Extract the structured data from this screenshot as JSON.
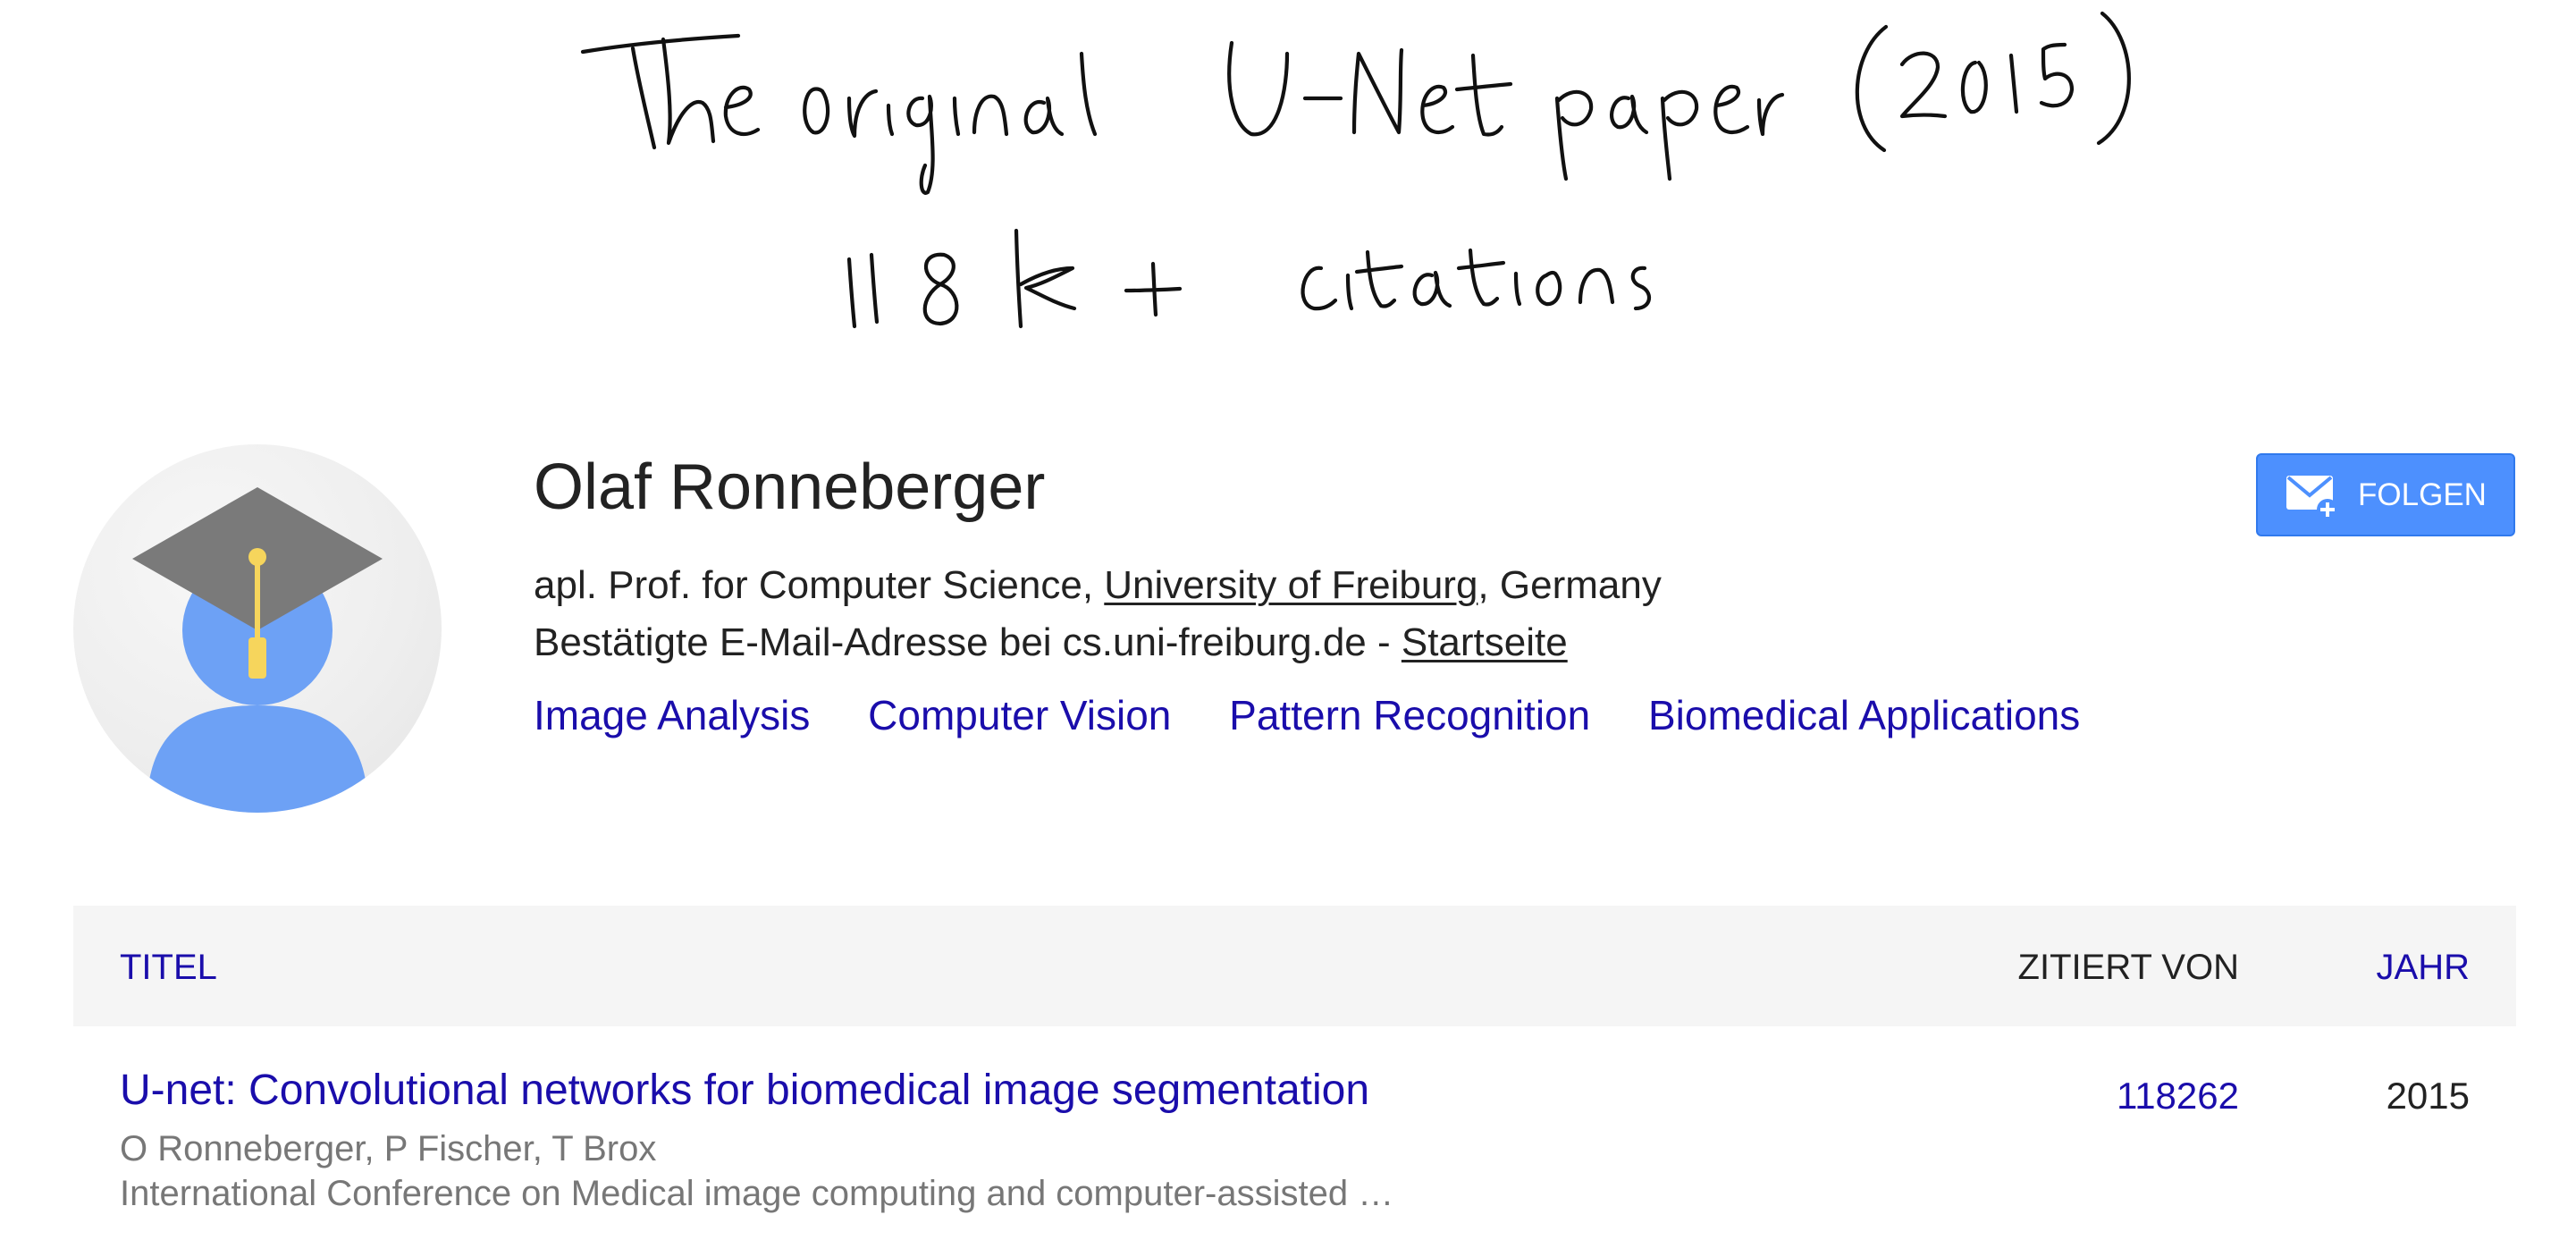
{
  "annotation": {
    "line1": "The original U-Net paper (2015)",
    "line2": "118k+ citations"
  },
  "profile": {
    "name": "Olaf Ronneberger",
    "affiliation_prefix": "apl. Prof. for Computer Science, ",
    "affiliation_link": "University of Freiburg",
    "affiliation_suffix": ", Germany",
    "email_text": "Bestätigte E-Mail-Adresse bei cs.uni-freiburg.de - ",
    "homepage_label": "Startseite",
    "interests": [
      "Image Analysis",
      "Computer Vision",
      "Pattern Recognition",
      "Biomedical Applications"
    ]
  },
  "follow_button": {
    "label": "FOLGEN",
    "color": "#4d90fe"
  },
  "table": {
    "headers": {
      "title": "TITEL",
      "cited_by": "ZITIERT VON",
      "year": "JAHR"
    },
    "rows": [
      {
        "title": "U-net: Convolutional networks for biomedical image segmentation",
        "authors": "O Ronneberger, P Fischer, T Brox",
        "venue": "International Conference on Medical image computing and computer-assisted …",
        "cited_by": "118262",
        "year": "2015"
      }
    ]
  },
  "colors": {
    "link": "#1a0dab",
    "text": "#222222",
    "muted": "#777777",
    "header_bg": "#f5f5f5",
    "avatar_body": "#6da1f5",
    "avatar_cap": "#7a7a7a",
    "avatar_tassel": "#f6d55c"
  },
  "icons": {
    "avatar": "graduate-avatar-icon",
    "follow": "mail-plus-icon"
  }
}
